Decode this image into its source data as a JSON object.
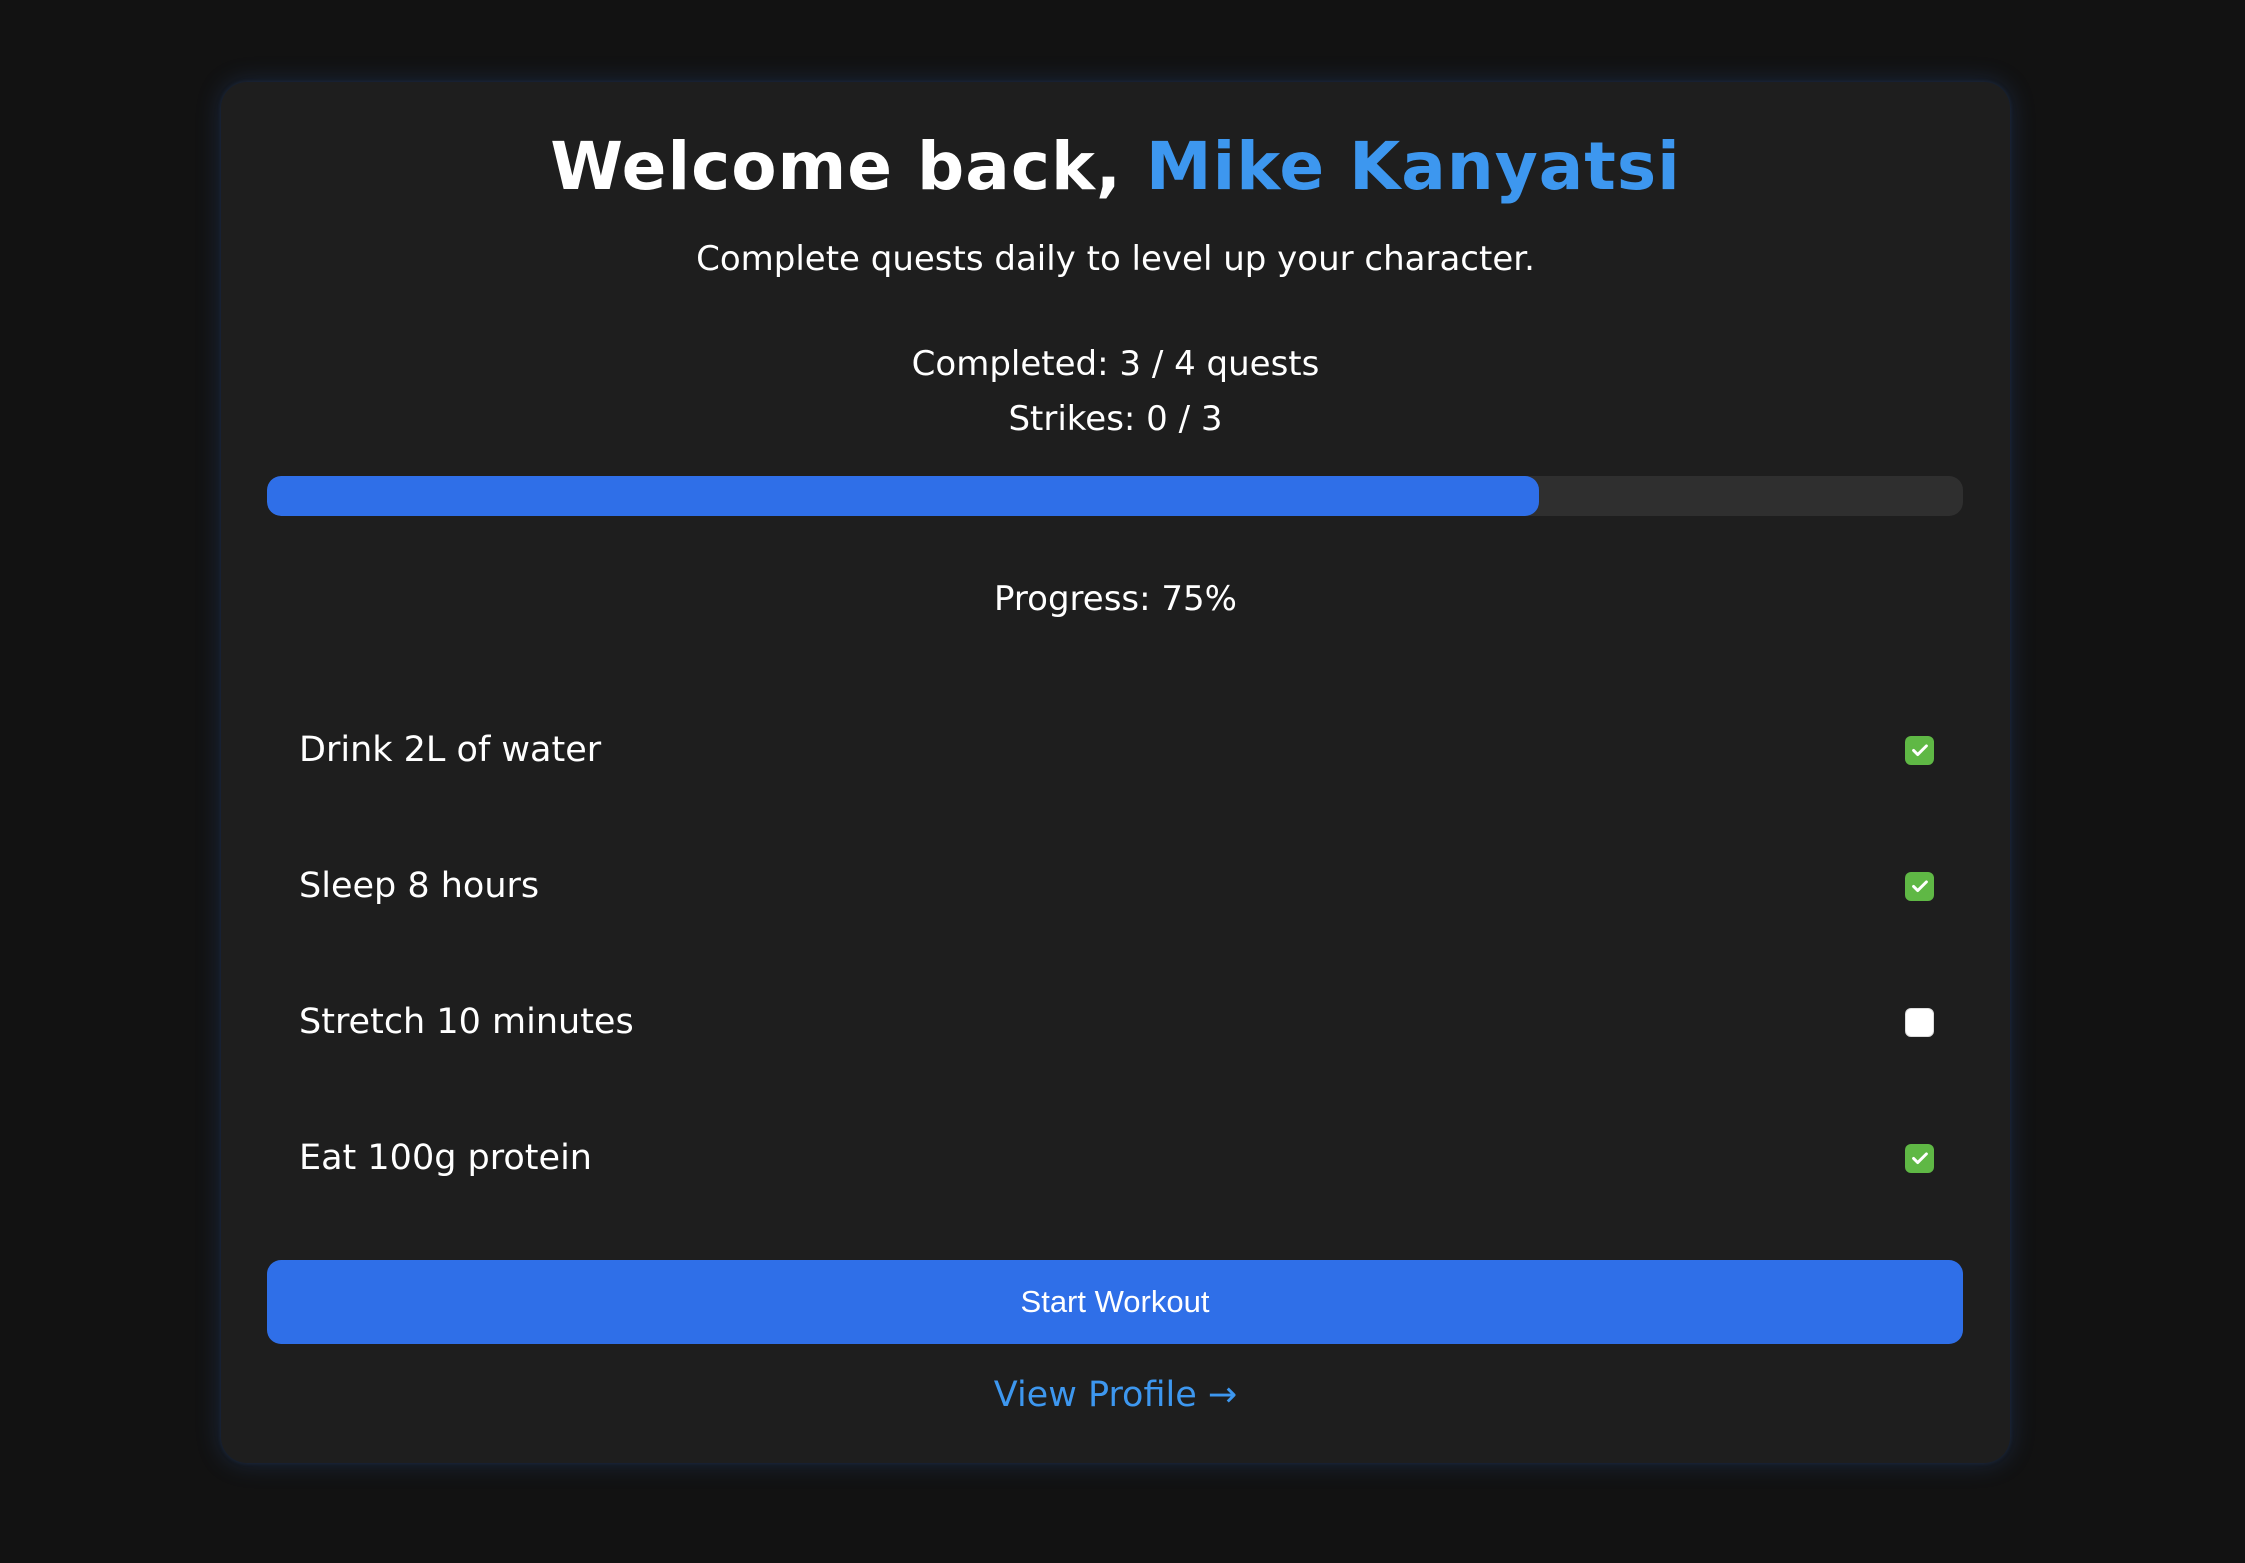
{
  "header": {
    "greeting": "Welcome back, ",
    "user_name": "Mike Kanyatsi",
    "subtitle": "Complete quests daily to level up your character."
  },
  "stats": {
    "completed_text": "Completed: 3 / 4 quests",
    "strikes_text": "Strikes: 0 / 3"
  },
  "progress": {
    "fraction": 0.75,
    "label": "Progress: 75%"
  },
  "quests": [
    {
      "label": "Drink 2L of water",
      "done": true
    },
    {
      "label": "Sleep 8 hours",
      "done": true
    },
    {
      "label": "Stretch 10 minutes",
      "done": false
    },
    {
      "label": "Eat 100g protein",
      "done": true
    }
  ],
  "actions": {
    "start_label": "Start Workout",
    "profile_label": "View Profile →"
  },
  "colors": {
    "accent": "#2f6fe8",
    "name_highlight": "#3d97ef",
    "check_green": "#5fb845"
  }
}
